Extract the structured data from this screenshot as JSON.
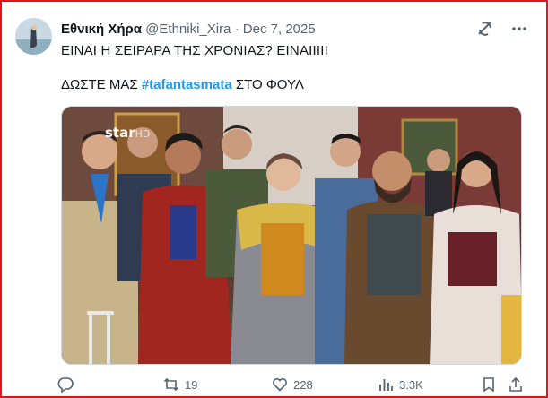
{
  "tweet": {
    "display_name": "Εθνική Χήρα",
    "handle": "@Ethniki_Xira",
    "separator": "·",
    "date": "Dec 7, 2025",
    "text_line1": "ΕΙΝΑΙ Η ΣΕΙΡΑΡΑ ΤΗΣ ΧΡΟΝΙΑΣ? ΕΙΝΑΙΙΙΙΙ",
    "text_line2_prefix": "ΔΩΣΤΕ ΜΑΣ ",
    "hashtag": "#tafantasmata",
    "text_line2_suffix": " ΣΤΟ ΦΟΥΛ"
  },
  "media": {
    "watermark_main": "star",
    "watermark_hd": "HD"
  },
  "actions": {
    "reply_count": "",
    "retweet_count": "19",
    "like_count": "228",
    "views_count": "3.3K"
  },
  "icons": {
    "grok": "grok-icon",
    "more": "more-icon",
    "reply": "reply-icon",
    "retweet": "retweet-icon",
    "like": "like-icon",
    "views": "views-icon",
    "bookmark": "bookmark-icon",
    "share": "share-icon"
  },
  "colors": {
    "border": "#e0161b",
    "hashtag": "#1d9bf0",
    "muted": "#536471"
  }
}
